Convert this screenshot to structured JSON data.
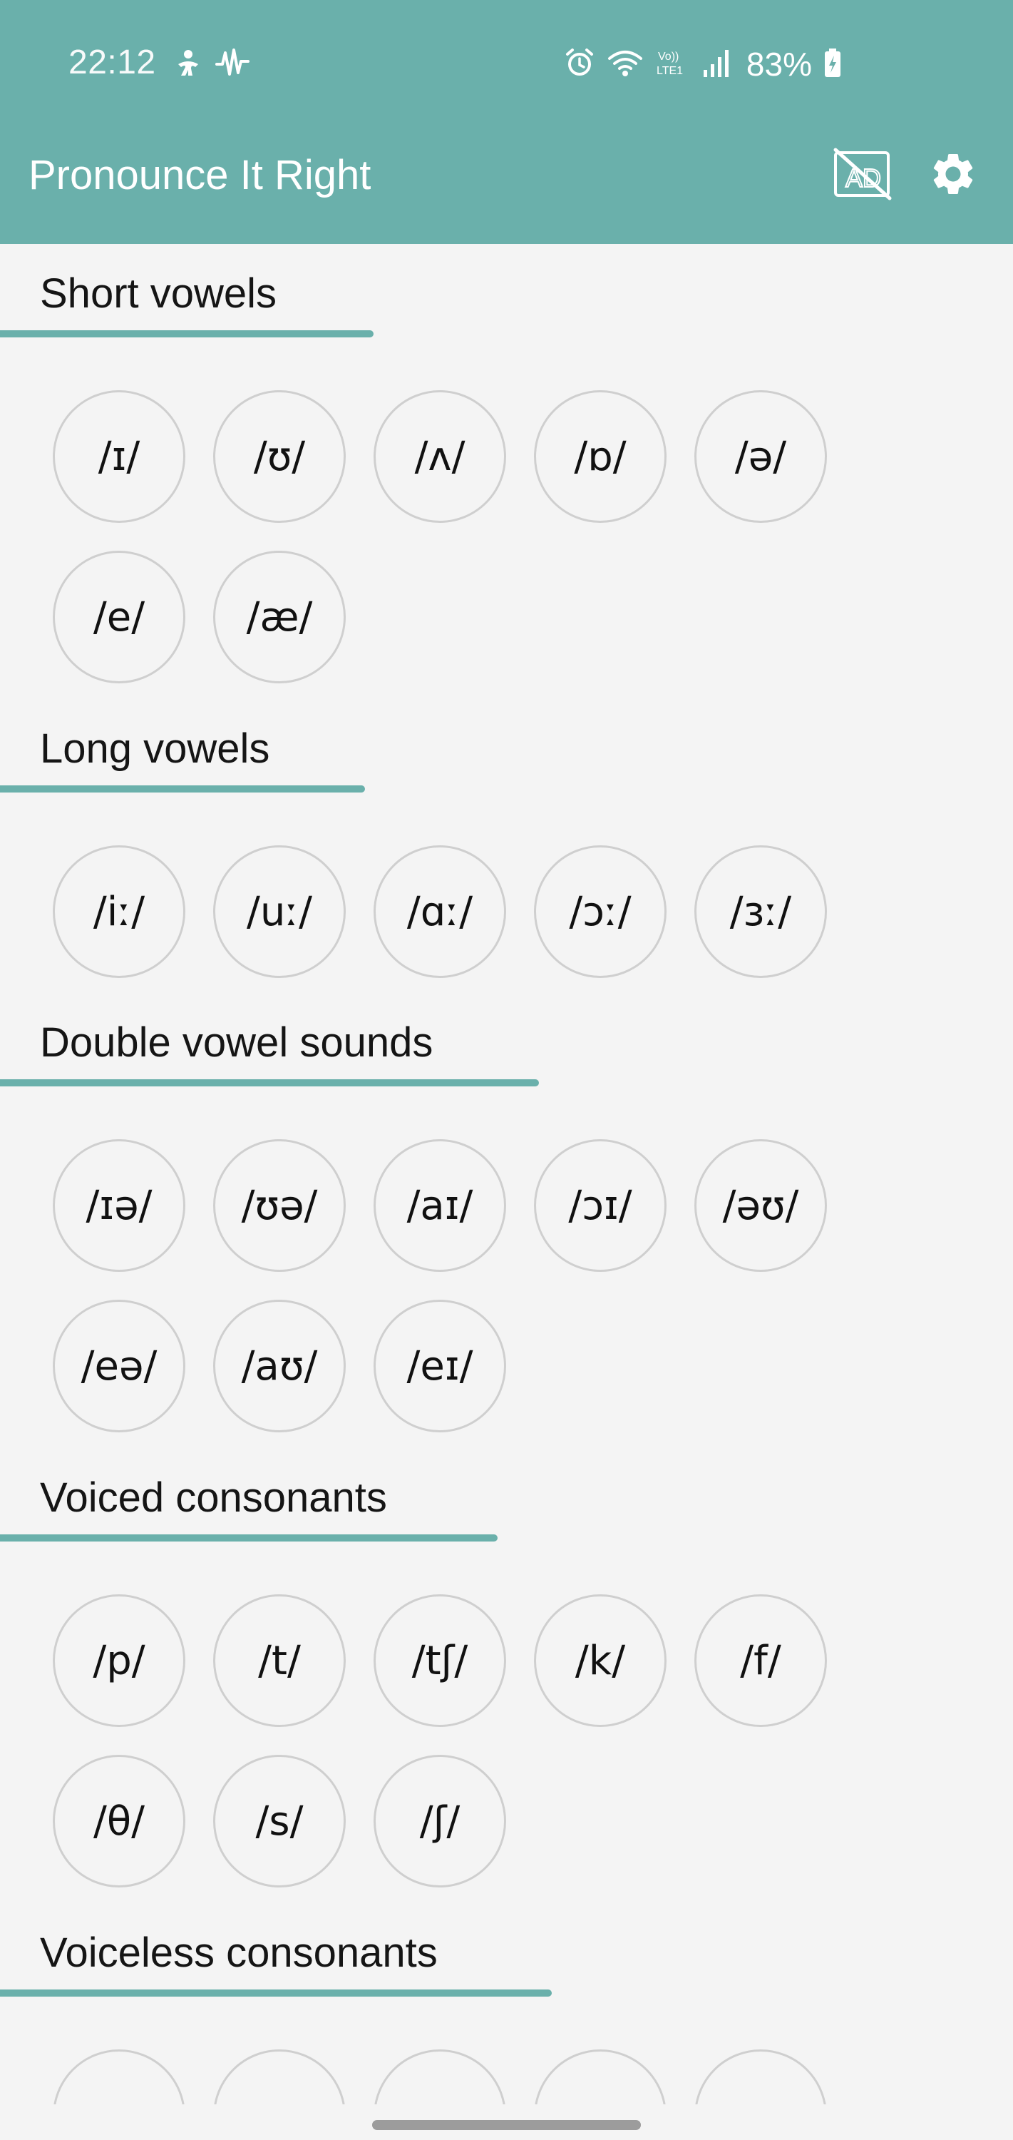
{
  "status_bar": {
    "time": "22:12",
    "battery_percent": "83%",
    "left_icons": [
      "accessibility-icon",
      "audio-wave-icon"
    ],
    "right_icons": [
      "alarm-icon",
      "wifi-icon",
      "volte-icon",
      "signal-icon",
      "battery-charging-icon"
    ],
    "volte_label": "Vo)) LTE1"
  },
  "app_bar": {
    "title": "Pronounce It Right",
    "actions": [
      "ads-off-icon",
      "gear-icon"
    ],
    "ads_icon_text": "AD"
  },
  "colors": {
    "accent": "#6ab0ab",
    "background": "#f4f4f4",
    "circle_border": "#cfcfcf"
  },
  "sections": [
    {
      "title": "Short vowels",
      "items": [
        "/ɪ/",
        "/ʊ/",
        "/ʌ/",
        "/ɒ/",
        "/ə/",
        "/e/",
        "/æ/"
      ]
    },
    {
      "title": "Long vowels",
      "items": [
        "/iː/",
        "/uː/",
        "/ɑː/",
        "/ɔː/",
        "/ɜː/"
      ]
    },
    {
      "title": "Double vowel sounds",
      "items": [
        "/ɪə/",
        "/ʊə/",
        "/aɪ/",
        "/ɔɪ/",
        "/əʊ/",
        "/eə/",
        "/aʊ/",
        "/eɪ/"
      ]
    },
    {
      "title": "Voiced consonants",
      "items": [
        "/p/",
        "/t/",
        "/tʃ/",
        "/k/",
        "/f/",
        "/θ/",
        "/s/",
        "/ʃ/"
      ]
    },
    {
      "title": "Voiceless consonants",
      "items": []
    }
  ]
}
